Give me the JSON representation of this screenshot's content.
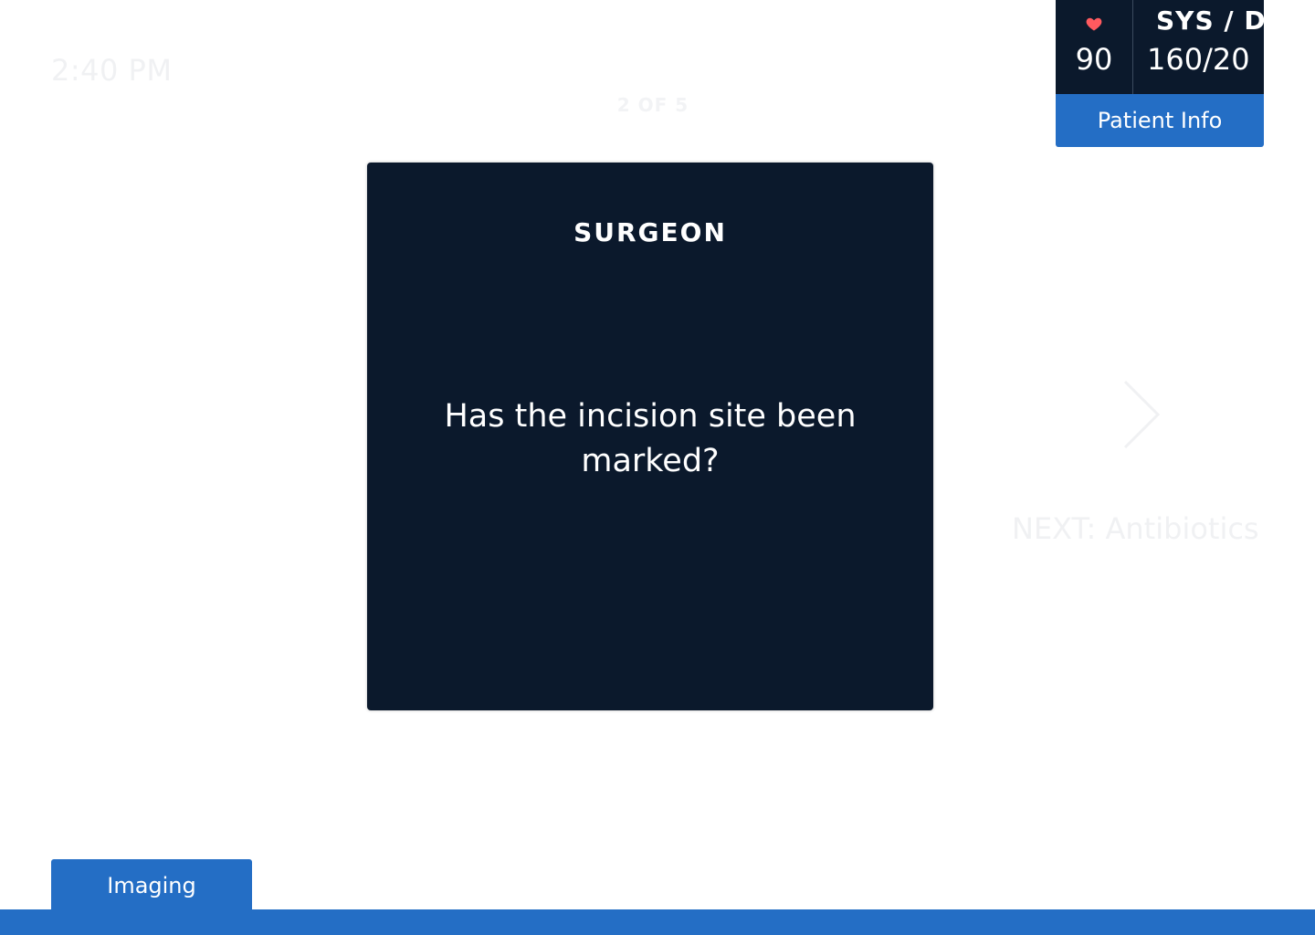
{
  "header": {
    "time": "2:40 PM",
    "step": "2 OF 5"
  },
  "vitals": {
    "heart_rate": "90",
    "bp_label": "SYS / DIA",
    "bp_value": "160/20",
    "patient_info_label": "Patient Info",
    "heart_icon": "heart-icon",
    "heart_color": "#ff5a5f"
  },
  "card": {
    "role": "SURGEON",
    "question": "Has the incision site been marked?"
  },
  "navigation": {
    "next_label": "NEXT: Antibiotics",
    "next_icon": "chevron-right-icon"
  },
  "footer": {
    "imaging_label": "Imaging"
  },
  "colors": {
    "card_bg": "#0b192c",
    "accent": "#246ec5"
  }
}
